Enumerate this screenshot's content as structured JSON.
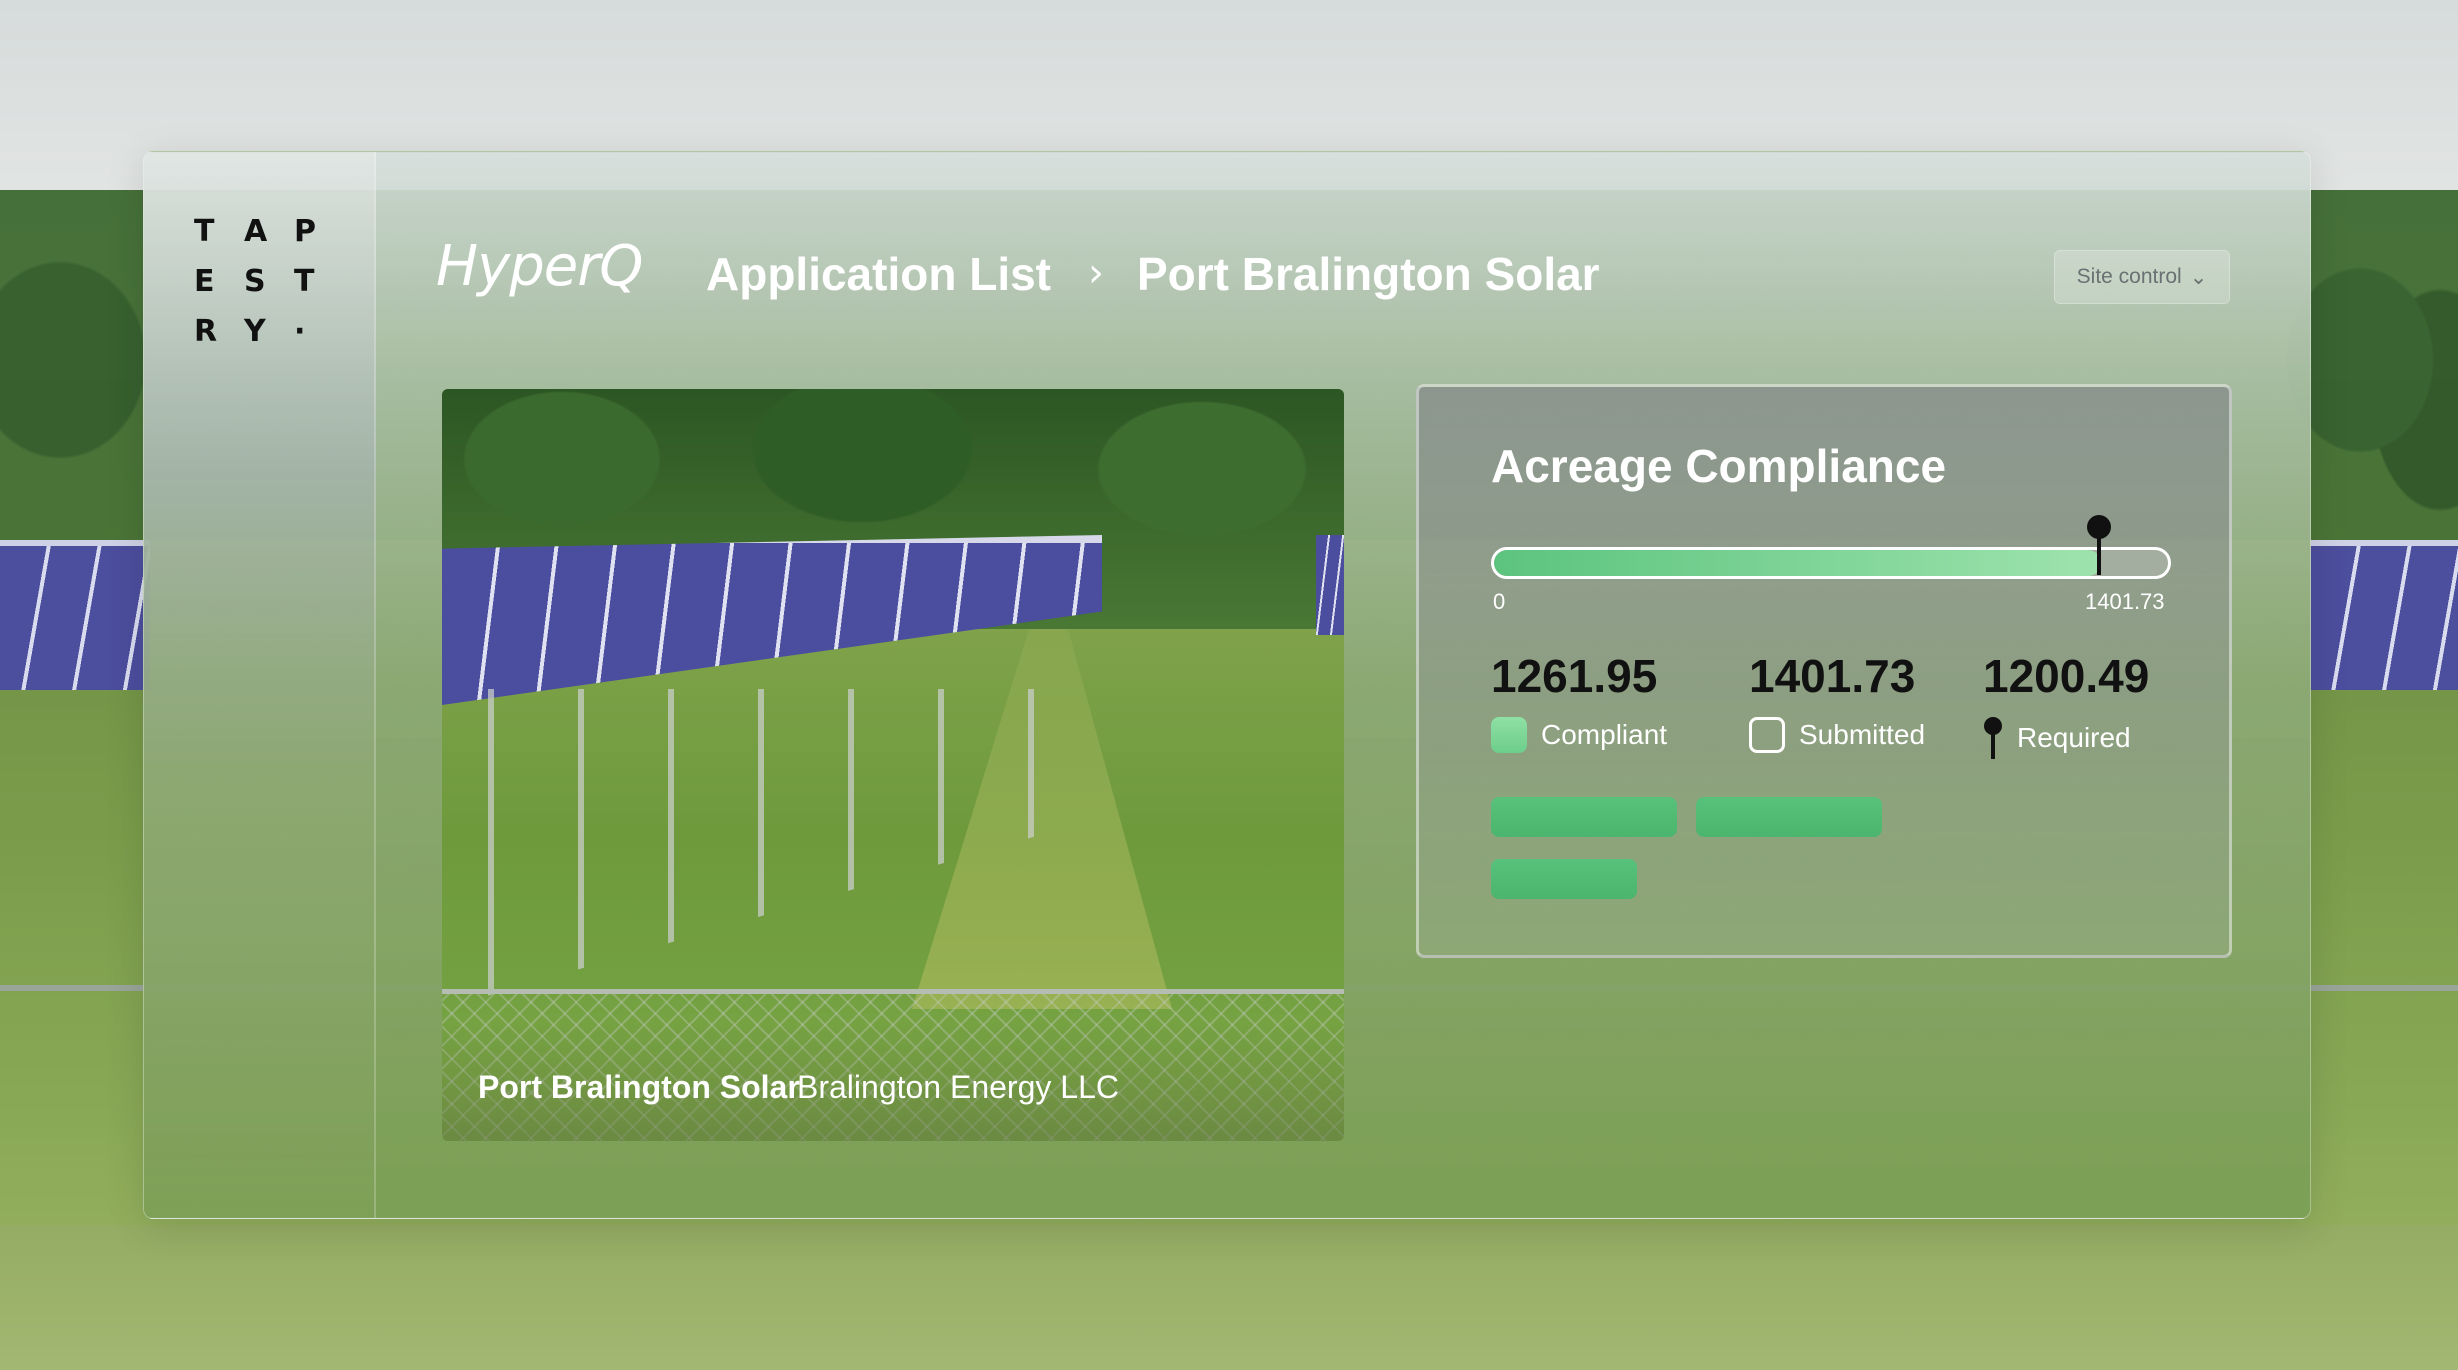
{
  "logo": {
    "letters": [
      "T",
      "A",
      "P",
      "E",
      "S",
      "T",
      "R",
      "Y",
      "·"
    ]
  },
  "header": {
    "brand": "HyperQ",
    "breadcrumb": {
      "list_label": "Application List",
      "separator": "›",
      "current": "Port Bralington Solar"
    },
    "site_control": {
      "label": "Site control",
      "chevron": "⌄"
    }
  },
  "photo_card": {
    "title": "Port Bralington Solar",
    "subtitle": "Bralington Energy LLC"
  },
  "compliance": {
    "title": "Acreage Compliance",
    "scale_min_label": "0",
    "scale_max_label": "1401.73",
    "scale_max": 1401.73,
    "compliant_value": 1261.95,
    "submitted_value": 1401.73,
    "required_value": 1200.49,
    "stats": {
      "compliant": {
        "value": "1261.95",
        "label": "Compliant"
      },
      "submitted": {
        "value": "1401.73",
        "label": "Submitted"
      },
      "required": {
        "value": "1200.49",
        "label": "Required"
      }
    },
    "icons": {
      "compliant": "filled-square-icon",
      "submitted": "outline-square-icon",
      "required": "pin-marker-icon"
    }
  },
  "colors": {
    "accent_green": "#5cc47e",
    "pill_green": "#4bb56d",
    "marker": "#111111"
  }
}
